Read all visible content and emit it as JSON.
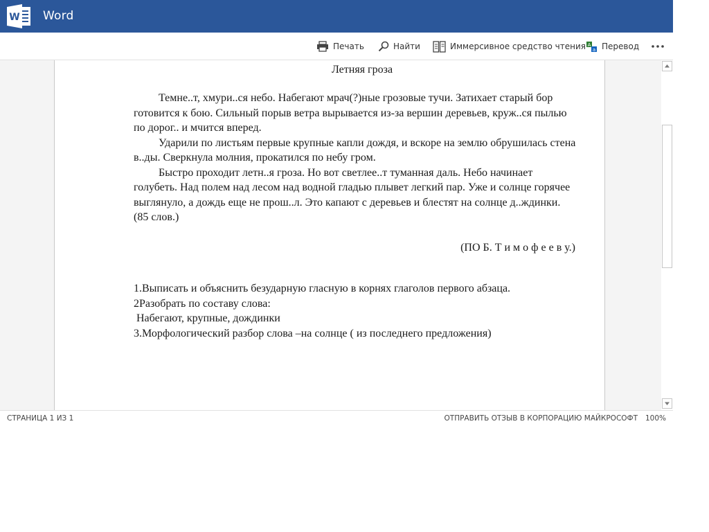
{
  "app": {
    "name": "Word",
    "brand_color": "#2b579a"
  },
  "toolbar": {
    "print_label": "Печать",
    "find_label": "Найти",
    "immersive_label": "Иммерсивное средство чтения",
    "translate_label": "Перевод",
    "more_icon": "ellipsis-icon"
  },
  "document": {
    "title": "Летняя гроза",
    "paragraphs": [
      "Темне..т, хмури..ся небо. Набегают мрач(?)ные грозовые тучи. Затихает старый бор  готовится к бою. Сильный порыв ветра вырывается из-за вершин деревьев, круж..ся пылью по дорог..  и мчится вперед.",
      "Ударили по листьям первые крупные капли дождя, и вскоре на землю обрушилась стена в..ды. Сверкнула молния, прокатился по небу гром.",
      "Быстро проходит летн..я гроза. Но вот светлее..т туманная даль. Небо начинает голубеть. Над полем  над лесом  над водной гладью плывет легкий пар. Уже и солнце горячее выглянуло, а дождь еще не прош..л. Это капают с деревьев и блестят на солнце д..ждинки. (85 слов.)"
    ],
    "author": "(ПО Б. Т и м о ф е е в у.)",
    "tasks": [
      "1.Выписать и объяснить безударную гласную в корнях глаголов первого абзаца.",
      "2Разобрать по составу слова:",
      " Набегают, крупные, дождинки",
      "3.Морфологический разбор слова –на солнце ( из последнего предложения)"
    ]
  },
  "statusbar": {
    "page_info": "СТРАНИЦА 1 ИЗ 1",
    "feedback": "ОТПРАВИТЬ ОТЗЫВ В КОРПОРАЦИЮ МАЙКРОСОФТ",
    "zoom": "100%"
  }
}
